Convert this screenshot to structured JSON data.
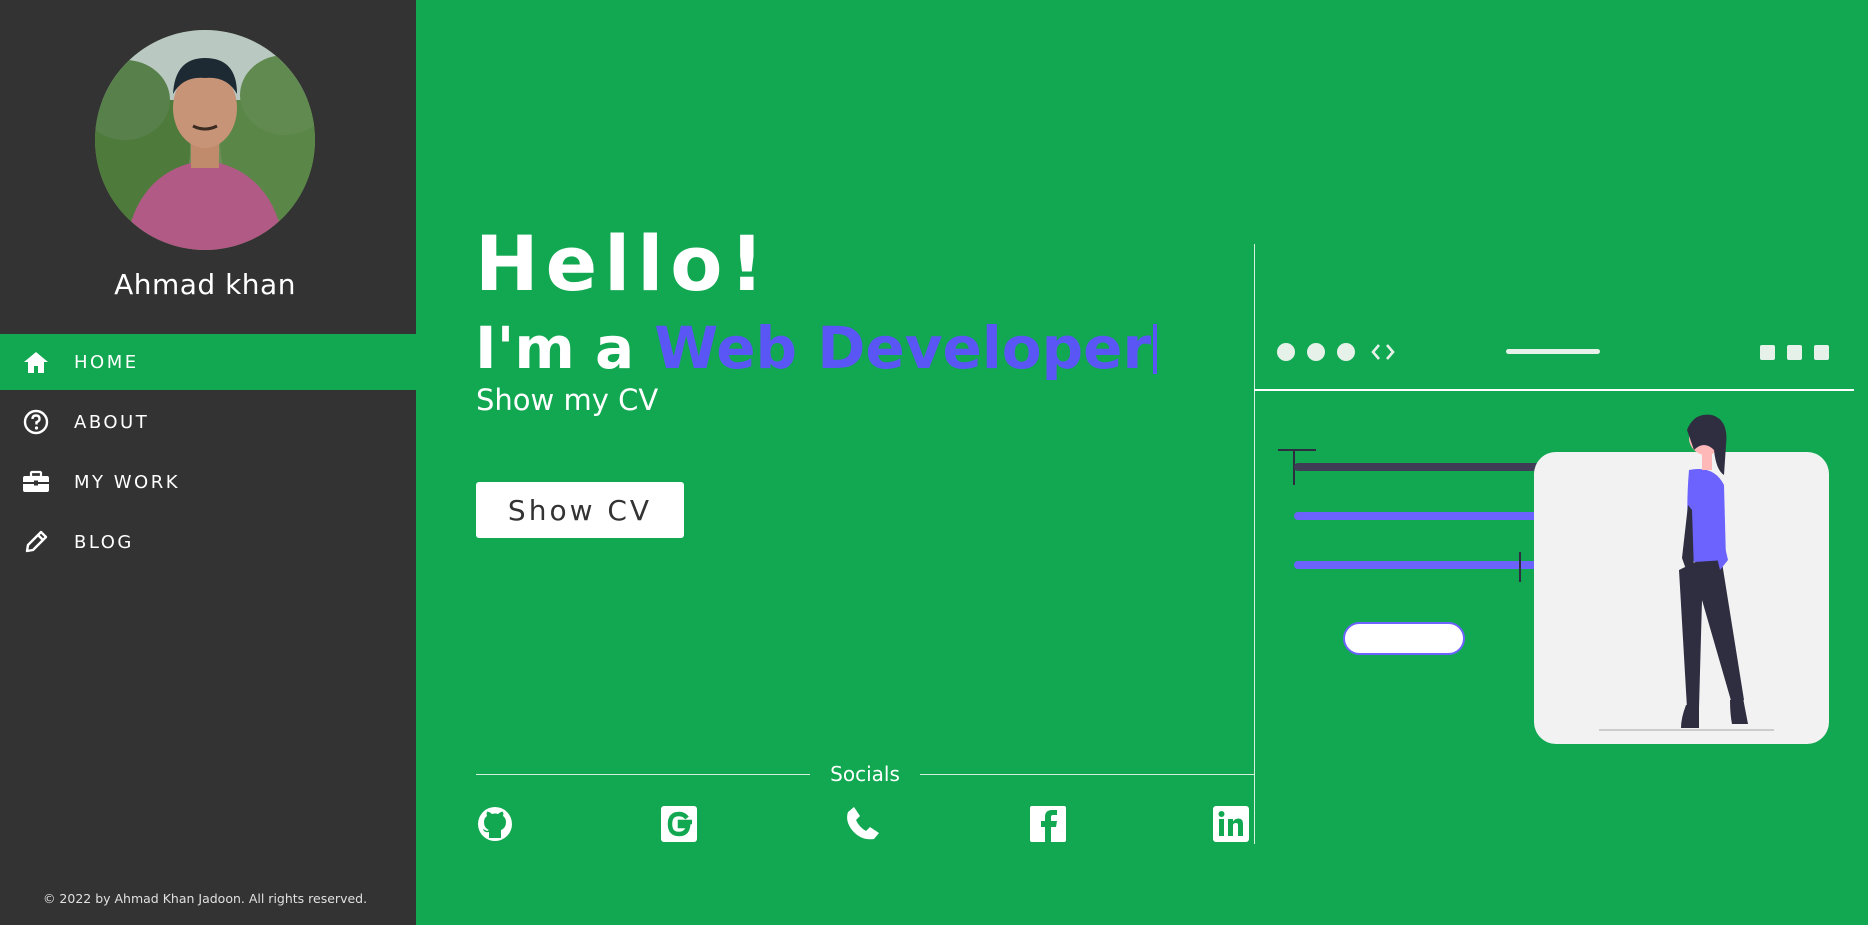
{
  "sidebar": {
    "profile_name": "Ahmad khan",
    "nav": [
      {
        "label": "HOME",
        "icon": "home-icon",
        "active": true
      },
      {
        "label": "ABOUT",
        "icon": "question-circle-icon",
        "active": false
      },
      {
        "label": "MY WORK",
        "icon": "briefcase-icon",
        "active": false
      },
      {
        "label": "BLOG",
        "icon": "pencil-icon",
        "active": false
      }
    ],
    "copyright": "© 2022 by Ahmad Khan Jadoon. All rights reserved."
  },
  "hero": {
    "greeting": "Hello!",
    "intro": "I'm a ",
    "role": "Web Developer",
    "subtitle": "Show my CV",
    "cv_button": "Show CV"
  },
  "socials": {
    "label": "Socials",
    "links": [
      {
        "icon": "github-icon"
      },
      {
        "icon": "google-icon"
      },
      {
        "icon": "phone-icon"
      },
      {
        "icon": "facebook-icon"
      },
      {
        "icon": "linkedin-icon"
      }
    ]
  },
  "colors": {
    "primary_green": "#11a851",
    "sidebar_bg": "#333333",
    "accent_purple": "#5a55f5"
  }
}
